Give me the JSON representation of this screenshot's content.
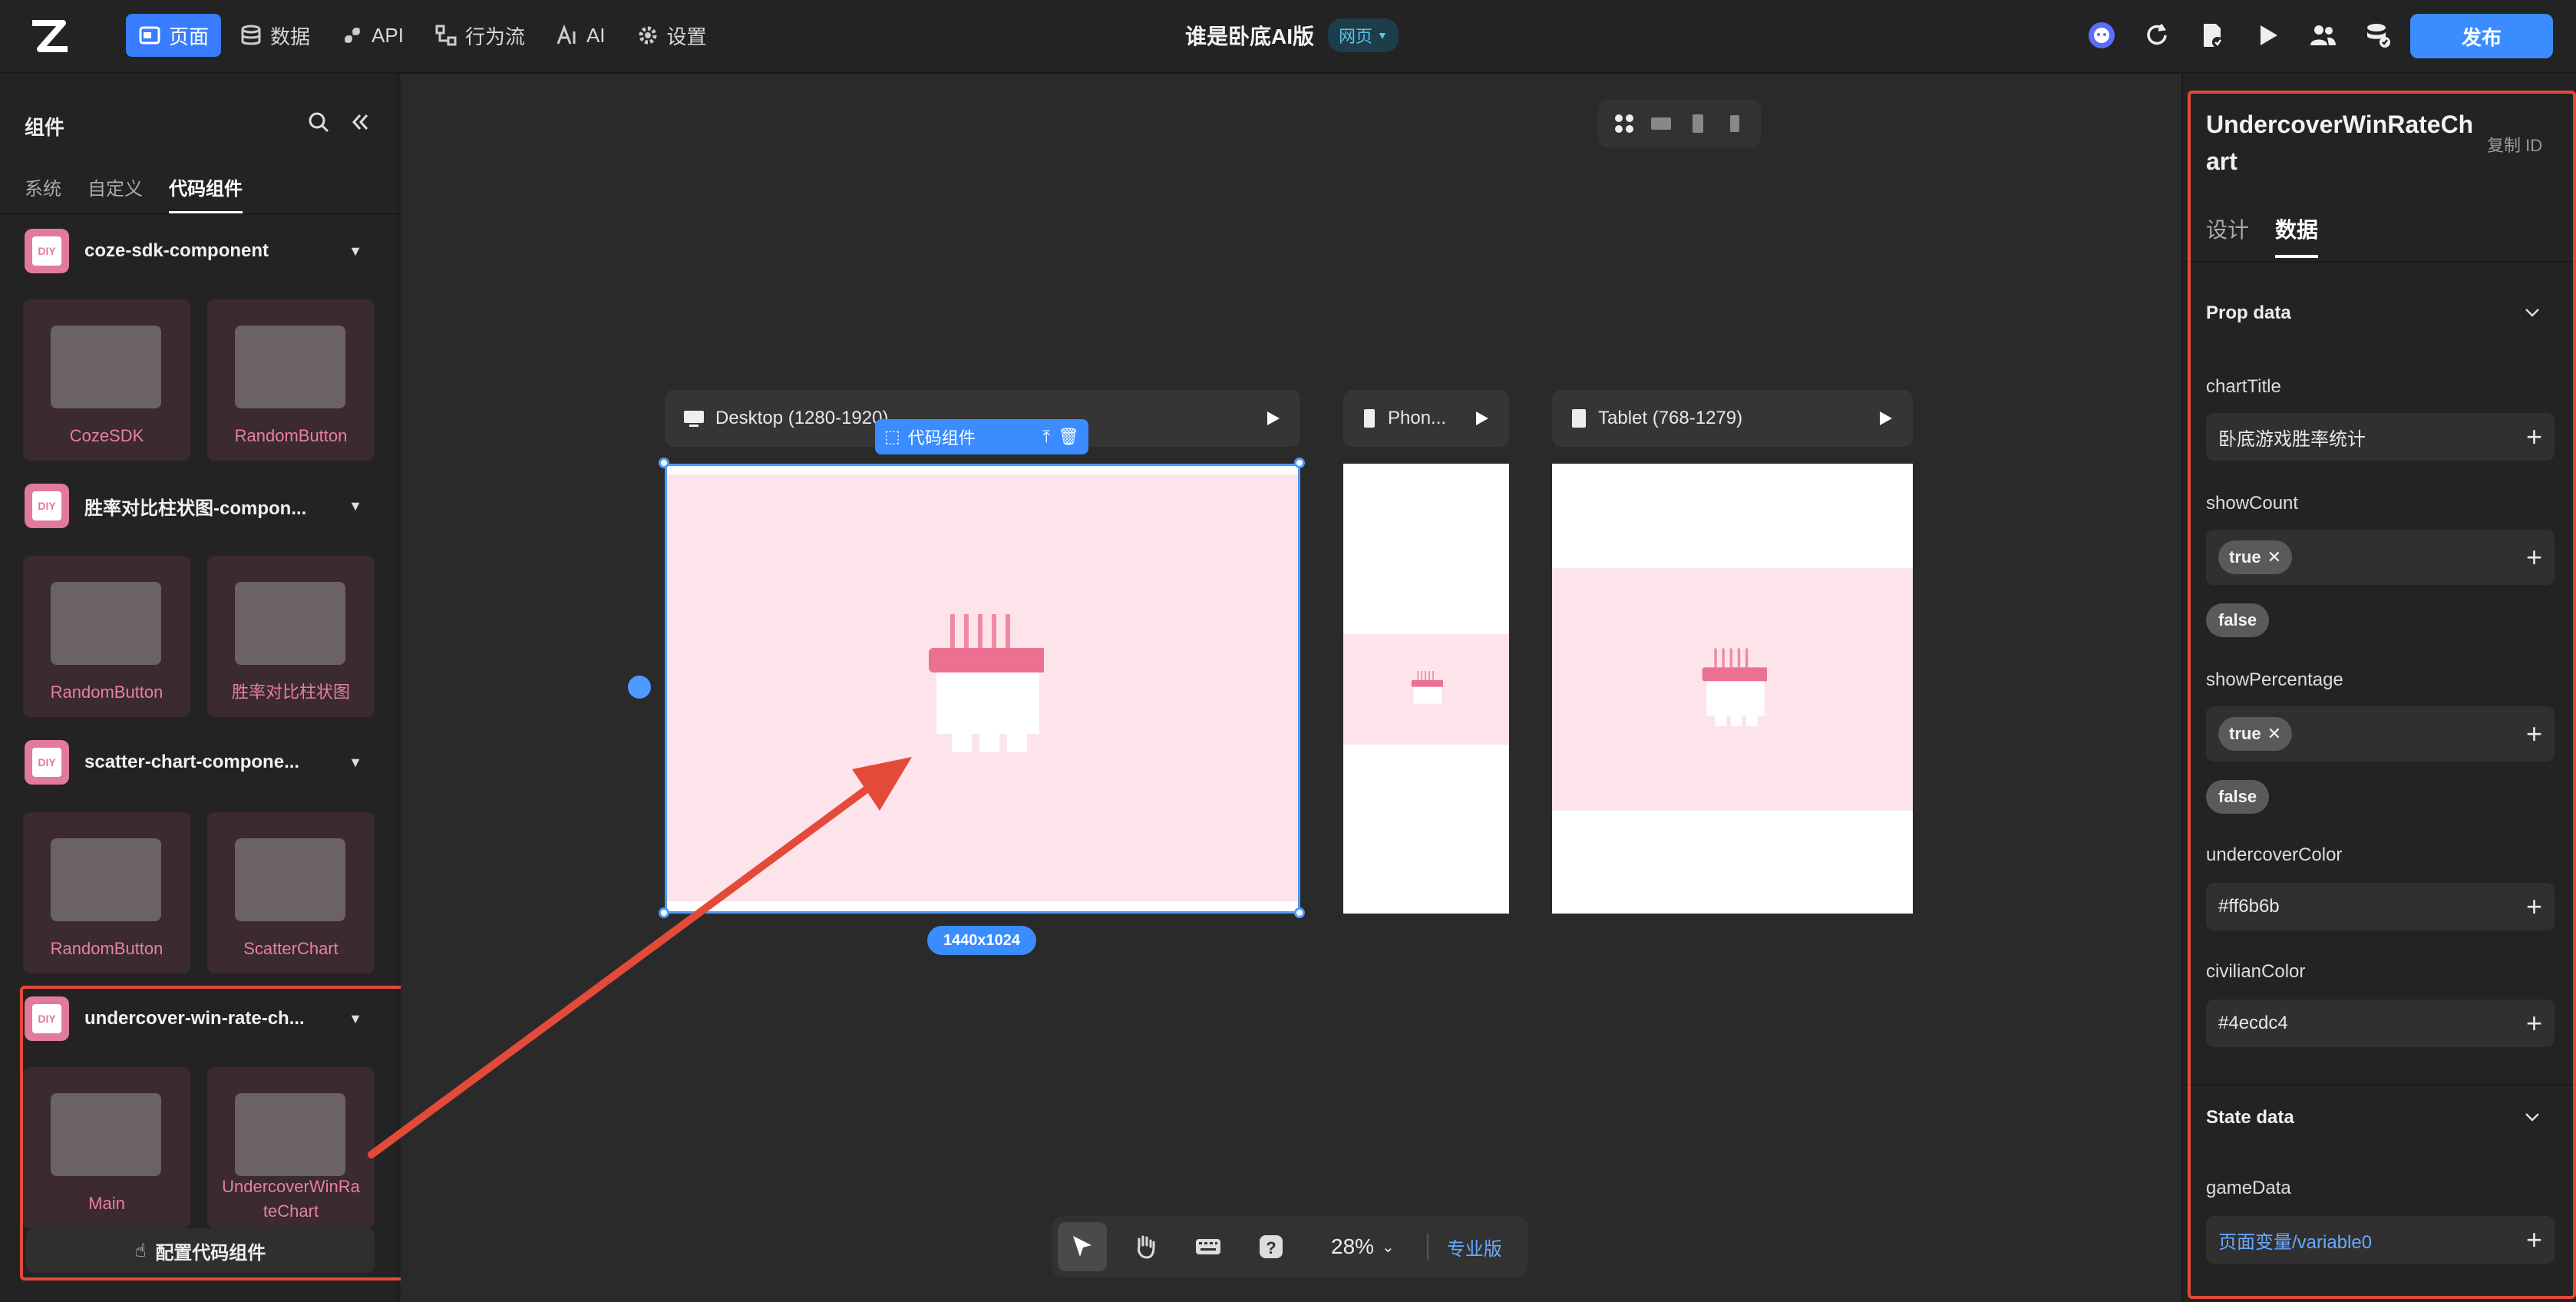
{
  "topbar": {
    "nav": [
      {
        "label": "页面",
        "icon": "page-icon",
        "active": true
      },
      {
        "label": "数据",
        "icon": "database-icon",
        "active": false
      },
      {
        "label": "API",
        "icon": "api-icon",
        "active": false
      },
      {
        "label": "行为流",
        "icon": "workflow-icon",
        "active": false
      },
      {
        "label": "AI",
        "icon": "ai-icon",
        "active": false
      },
      {
        "label": "设置",
        "icon": "gear-icon",
        "active": false
      }
    ],
    "app_title": "谁是卧底AI版",
    "type_badge": "网页",
    "publish_label": "发布",
    "accent": "#3a8cff"
  },
  "left_panel": {
    "title": "组件",
    "tabs": [
      "系统",
      "自定义",
      "代码组件"
    ],
    "active_tab": "代码组件",
    "groups": [
      {
        "name": "coze-sdk-component",
        "items": [
          "CozeSDK",
          "RandomButton"
        ]
      },
      {
        "name": "胜率对比柱状图-compon...",
        "items": [
          "RandomButton",
          "胜率对比柱状图"
        ]
      },
      {
        "name": "scatter-chart-compone...",
        "items": [
          "RandomButton",
          "ScatterChart"
        ]
      },
      {
        "name": "undercover-win-rate-ch...",
        "items": [
          "Main",
          "UndercoverWinRa teChart"
        ]
      }
    ],
    "config_button": "配置代码组件",
    "diy_label": "DIY"
  },
  "canvas": {
    "frames": [
      {
        "label": "Desktop (1280-1920)"
      },
      {
        "label": "Phon..."
      },
      {
        "label": "Tablet (768-1279)"
      }
    ],
    "selection_label": "代码组件",
    "size_badge": "1440x1024",
    "zoom": "28%",
    "pro_label": "专业版",
    "pink_color": "#fce4ea"
  },
  "right_panel": {
    "component_name": "UndercoverWinRateChart",
    "copy_id": "复制 ID",
    "tabs": [
      "设计",
      "数据"
    ],
    "active_tab": "数据",
    "prop_section": "Prop data",
    "props": {
      "chartTitle": {
        "label": "chartTitle",
        "value": "卧底游戏胜率统计"
      },
      "showCount": {
        "label": "showCount",
        "chip": "true",
        "option": "false"
      },
      "showPercentage": {
        "label": "showPercentage",
        "chip": "true",
        "option": "false"
      },
      "undercoverColor": {
        "label": "undercoverColor",
        "value": "#ff6b6b"
      },
      "civilianColor": {
        "label": "civilianColor",
        "value": "#4ecdc4"
      }
    },
    "state_section": "State data",
    "state": {
      "gameData": {
        "label": "gameData",
        "value": "页面变量/variable0"
      }
    }
  },
  "annotation_color": "#e34a3a"
}
